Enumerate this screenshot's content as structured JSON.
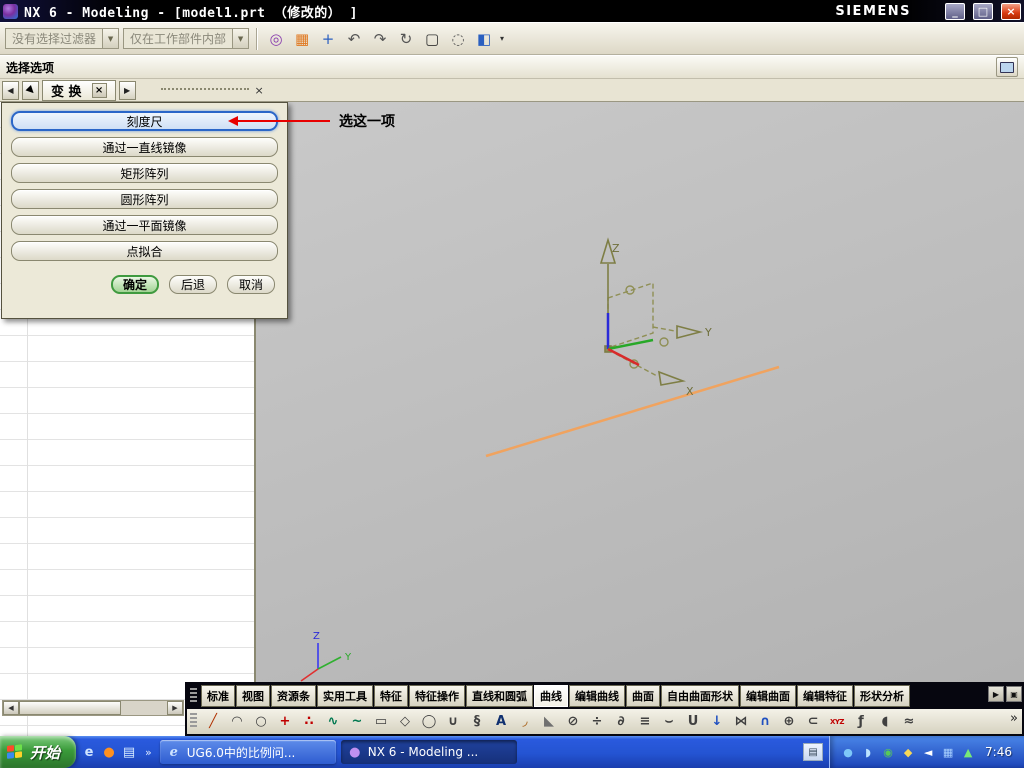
{
  "titlebar": {
    "title": "NX 6 - Modeling - [model1.prt （修改的） ]",
    "brand": "SIEMENS",
    "minimize_glyph": "_",
    "maximize_glyph": "□",
    "close_glyph": "×"
  },
  "toolbar": {
    "filter_value": "没有选择过滤器",
    "scope_value": "仅在工作部件内部",
    "dropdown_glyph": "▼",
    "caret_glyph": "▾",
    "icons": [
      {
        "name": "snap-point-icon",
        "glyph": "◎",
        "color": "#8a3fae"
      },
      {
        "name": "grid-icon",
        "glyph": "▦",
        "color": "#e07820"
      },
      {
        "name": "point-constructor-icon",
        "glyph": "+",
        "color": "#2a5fc0"
      },
      {
        "name": "undo-icon",
        "glyph": "↶",
        "color": "#555555"
      },
      {
        "name": "redo-icon",
        "glyph": "↷",
        "color": "#555555"
      },
      {
        "name": "refresh-view-icon",
        "glyph": "↻",
        "color": "#555555"
      },
      {
        "name": "selection-rectangle-icon",
        "glyph": "▢",
        "color": "#333333"
      },
      {
        "name": "lasso-selection-icon",
        "glyph": "◌",
        "color": "#555555"
      },
      {
        "name": "shaded-cube-icon",
        "glyph": "◧",
        "color": "#2a5fc0"
      }
    ]
  },
  "selection_bar": {
    "label": "选择选项"
  },
  "tabstrip": {
    "prev_glyph": "◀",
    "next_glyph": "▶",
    "cursor_glyph": "▶",
    "tab_label": "变 换",
    "close_glyph": "×",
    "handle_close_glyph": "×"
  },
  "dialog": {
    "options": [
      "刻度尺",
      "通过一直线镜像",
      "矩形阵列",
      "圆形阵列",
      "通过一平面镜像",
      "点拟合"
    ],
    "highlight_index": 0,
    "ok_label": "确定",
    "back_label": "后退",
    "cancel_label": "取消"
  },
  "annotation": {
    "text": "选这一项"
  },
  "viewport": {
    "wcs": {
      "z": "Z",
      "y": "Y",
      "x": "X"
    },
    "triad": {
      "z": "Z",
      "y": "Y",
      "x": "X"
    }
  },
  "left_panel": {
    "scroll_left_glyph": "◀",
    "scroll_right_glyph": "▶"
  },
  "dock": {
    "tabs": [
      "标准",
      "视图",
      "资源条",
      "实用工具",
      "特征",
      "特征操作",
      "直线和圆弧",
      "曲线",
      "编辑曲线",
      "曲面",
      "自由曲面形状",
      "编辑曲面",
      "编辑特征",
      "形状分析"
    ],
    "active_tab": "曲线",
    "expand_glyph": "▶",
    "window_glyph": "▣",
    "overflow_glyph": "»",
    "tools": [
      {
        "name": "line-icon",
        "glyph": "╱",
        "color": "#b03000"
      },
      {
        "name": "arc-icon",
        "glyph": "◠",
        "color": "#404040"
      },
      {
        "name": "circle-icon",
        "glyph": "○",
        "color": "#404040"
      },
      {
        "name": "point-icon",
        "glyph": "+",
        "color": "#c00000"
      },
      {
        "name": "point-set-icon",
        "glyph": "∴",
        "color": "#c00000"
      },
      {
        "name": "spline-icon",
        "glyph": "∿",
        "color": "#007850"
      },
      {
        "name": "studio-spline-icon",
        "glyph": "~",
        "color": "#007850"
      },
      {
        "name": "rectangle-icon",
        "glyph": "▭",
        "color": "#404040"
      },
      {
        "name": "polygon-icon",
        "glyph": "◇",
        "color": "#404040"
      },
      {
        "name": "ellipse-icon",
        "glyph": "◯",
        "color": "#404040"
      },
      {
        "name": "conic-icon",
        "glyph": "∪",
        "color": "#404040"
      },
      {
        "name": "helix-icon",
        "glyph": "§",
        "color": "#404040"
      },
      {
        "name": "text-icon",
        "glyph": "A",
        "color": "#103070"
      },
      {
        "name": "fillet-icon",
        "glyph": "◞",
        "color": "#a05000"
      },
      {
        "name": "chamfer-icon",
        "glyph": "◣",
        "color": "#707070"
      },
      {
        "name": "trim-curve-icon",
        "glyph": "⊘",
        "color": "#404040"
      },
      {
        "name": "divide-curve-icon",
        "glyph": "÷",
        "color": "#404040"
      },
      {
        "name": "edit-curve-icon",
        "glyph": "∂",
        "color": "#404040"
      },
      {
        "name": "offset-curve-icon",
        "glyph": "≡",
        "color": "#404040"
      },
      {
        "name": "bridge-curve-icon",
        "glyph": "⌣",
        "color": "#404040"
      },
      {
        "name": "join-curve-icon",
        "glyph": "U",
        "color": "#404040"
      },
      {
        "name": "project-curve-icon",
        "glyph": "↓",
        "color": "#2050c0"
      },
      {
        "name": "mirror-curve-icon",
        "glyph": "⋈",
        "color": "#404040"
      },
      {
        "name": "intersection-curve-icon",
        "glyph": "∩",
        "color": "#2050c0"
      },
      {
        "name": "section-curve-icon",
        "glyph": "⊕",
        "color": "#404040"
      },
      {
        "name": "extract-curve-icon",
        "glyph": "⊂",
        "color": "#404040"
      },
      {
        "name": "xyz-point-icon",
        "glyph": "XYZ",
        "color": "#c00000"
      },
      {
        "name": "law-curve-icon",
        "glyph": "ƒ",
        "color": "#404040"
      },
      {
        "name": "wrap-curve-icon",
        "glyph": "◖",
        "color": "#404040"
      },
      {
        "name": "simplify-curve-icon",
        "glyph": "≈",
        "color": "#404040"
      }
    ]
  },
  "taskbar": {
    "start_label": "开始",
    "overflow_glyph": "»",
    "quick_launch": [
      {
        "name": "internet-explorer-icon",
        "glyph": "e",
        "color": "#cfe4ff"
      },
      {
        "name": "browser-icon",
        "glyph": "●",
        "color": "#ff9020"
      },
      {
        "name": "show-desktop-icon",
        "glyph": "▤",
        "color": "#d8ecff"
      }
    ],
    "tasks": [
      {
        "label": "UG6.0中的比例问...",
        "icon_glyph": "e",
        "icon_color": "#cfe4ff",
        "active": false
      },
      {
        "label": "NX 6 - Modeling ...",
        "icon_glyph": "●",
        "icon_color": "#c090f0",
        "active": true
      }
    ],
    "language_icon_glyph": "▤",
    "tray_icons": [
      {
        "name": "messenger-tray-icon",
        "glyph": "●",
        "color": "#7ec8f8"
      },
      {
        "name": "chat-tray-icon",
        "glyph": "◗",
        "color": "#bde4ff"
      },
      {
        "name": "security-tray-icon",
        "glyph": "◉",
        "color": "#58c858"
      },
      {
        "name": "im-tray-icon",
        "glyph": "◆",
        "color": "#f8d858"
      },
      {
        "name": "volume-tray-icon",
        "glyph": "◄",
        "color": "#ffffff"
      },
      {
        "name": "network-tray-icon",
        "glyph": "▦",
        "color": "#a8d0ff"
      },
      {
        "name": "update-tray-icon",
        "glyph": "▲",
        "color": "#78e878"
      }
    ],
    "clock": "7:46"
  }
}
